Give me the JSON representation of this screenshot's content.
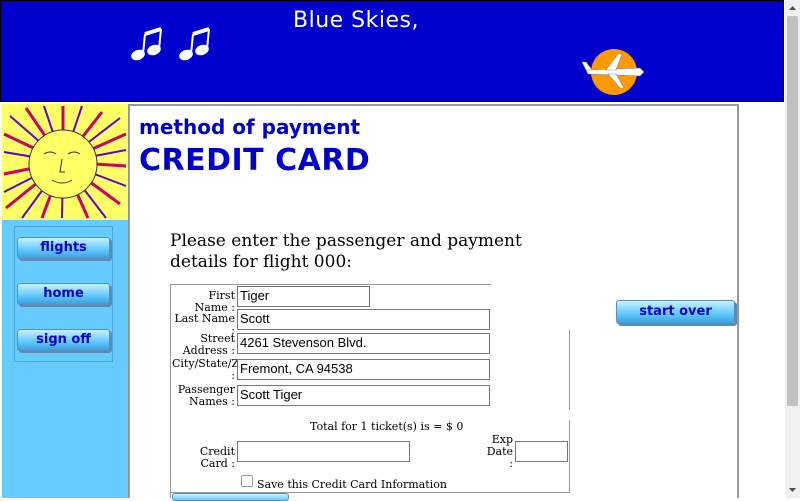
{
  "banner": {
    "title": "Blue Skies,"
  },
  "nav": {
    "flights": "flights",
    "home": "home",
    "signoff": "sign off"
  },
  "header": {
    "subtitle": "method of payment",
    "title": "CREDIT CARD"
  },
  "intro": "Please enter the passenger and payment details for flight 000:",
  "startover_label": "start over",
  "form": {
    "first_name_label": "First Name :",
    "first_name": "Tiger",
    "last_name_label": "Last Name :",
    "last_name": "Scott",
    "street_label_1": "Street",
    "street_label_2": "Address :",
    "street": "4261 Stevenson Blvd.",
    "csz_label_1": "City/State/Zip",
    "csz_label_2": ":",
    "csz": "Fremont, CA 94538",
    "passenger_label_1": "Passenger",
    "passenger_label_2": "Names :",
    "passengers": "Scott Tiger",
    "total": "Total for 1 ticket(s) is = $ 0",
    "cc_label": "Credit Card :",
    "cc_value": "",
    "exp_label_1": "Exp",
    "exp_label_2": "Date",
    "exp_label_3": ":",
    "exp_value": "",
    "save_label": "Save this Credit Card Information"
  },
  "colors": {
    "banner": "#0000cc",
    "nav_bg": "#66ccff",
    "heading": "#0000cc"
  }
}
